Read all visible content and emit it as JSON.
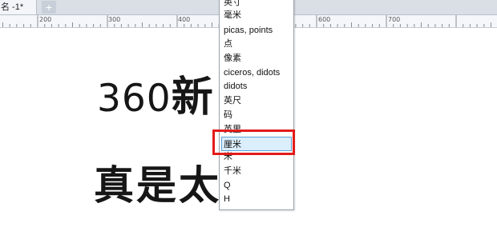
{
  "tab": {
    "title": "名 -1*",
    "add_label": "+"
  },
  "ruler": {
    "labels": [
      "200",
      "300",
      "400",
      "500",
      "600",
      "700"
    ]
  },
  "canvas_text": {
    "line1_regular": "360",
    "line1_bold": "新",
    "line2": "真是太  了"
  },
  "units_menu": {
    "items": [
      "英寸",
      "毫米",
      "picas, points",
      "点",
      "像素",
      "ciceros, didots",
      "didots",
      "英尺",
      "码",
      "英里",
      "厘米",
      "米",
      "千米",
      "Q",
      "H"
    ],
    "selected": "厘米"
  },
  "colors": {
    "highlight": "#e31b1b",
    "selected_bg": "#dbeefc"
  }
}
